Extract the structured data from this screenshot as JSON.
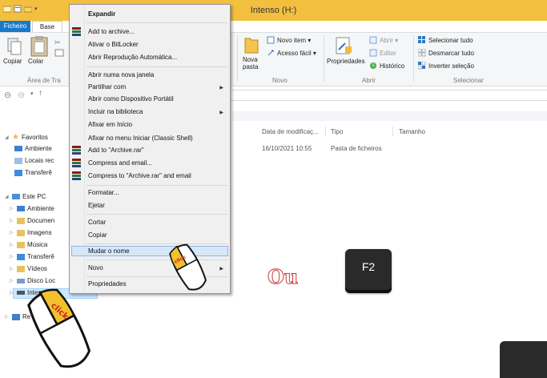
{
  "window": {
    "title": "Intenso (H:)"
  },
  "tabs": {
    "file": "Ficheiro",
    "home": "Base"
  },
  "ribbon": {
    "clipboard": {
      "copy": "Copiar",
      "paste": "Colar",
      "group": "Área de Tra"
    },
    "new": {
      "new_item": "Novo item ▾",
      "easy_access": "Acesso fácil ▾",
      "new_folder_1": "Nova",
      "new_folder_2": "pasta",
      "group": "Novo"
    },
    "open": {
      "properties": "Propriedades",
      "open": "Abrir ▾",
      "edit": "Editar",
      "history": "Histórico",
      "group": "Abrir"
    },
    "select": {
      "select_all": "Selecionar tudo",
      "select_none": "Desmarcar tudo",
      "invert": "Inverter seleção",
      "group": "Selecionar"
    }
  },
  "filelist": {
    "columns": {
      "date": "Data de modificaç...",
      "type": "Tipo",
      "size": "Tamanho"
    },
    "rows": [
      {
        "date": "16/10/2021 10:55",
        "type": "Pasta de ficheiros"
      }
    ]
  },
  "navpane": {
    "favorites": "Favoritos",
    "fav_items": [
      "Ambiente",
      "Locais rec",
      "Transferê"
    ],
    "thispc": "Este PC",
    "pc_items": [
      "Ambiente",
      "Documen",
      "Imagens",
      "Música",
      "Transferê",
      "Vídeos",
      "Disco Loc",
      "Inten"
    ],
    "network": "Re"
  },
  "context_menu": {
    "items": [
      {
        "label": "Expandir",
        "bold": true
      },
      {
        "label": "Add to archive..."
      },
      {
        "label": "Ativar o BitLocker"
      },
      {
        "label": "Abrir Reprodução Automática..."
      },
      {
        "label": "Abrir numa nova janela"
      },
      {
        "label": "Partilhar com"
      },
      {
        "label": "Abrir como Dispositivo Portátil"
      },
      {
        "label": "Incluir na biblioteca"
      },
      {
        "label": "Afixar em Início"
      },
      {
        "label": "Afixar no menu Iniciar (Classic Shell)"
      },
      {
        "label": "Add to \"Archive.rar\""
      },
      {
        "label": "Compress and email..."
      },
      {
        "label": "Compress to \"Archive.rar\" and email"
      },
      {
        "label": "Formatar..."
      },
      {
        "label": "Ejetar"
      },
      {
        "label": "Cortar"
      },
      {
        "label": "Copiar"
      },
      {
        "label": "Mudar o nome"
      },
      {
        "label": "Novo"
      },
      {
        "label": "Propriedades"
      }
    ]
  },
  "overlay": {
    "or_text": "Ou",
    "key_label": "F2",
    "click_label": "click",
    "mouse_small_label": "click"
  },
  "colors": {
    "titlebar": "#f3bf3f",
    "file_tab": "#1979ca",
    "highlight": "#d7e6f8",
    "accent_red": "#c8393f"
  }
}
